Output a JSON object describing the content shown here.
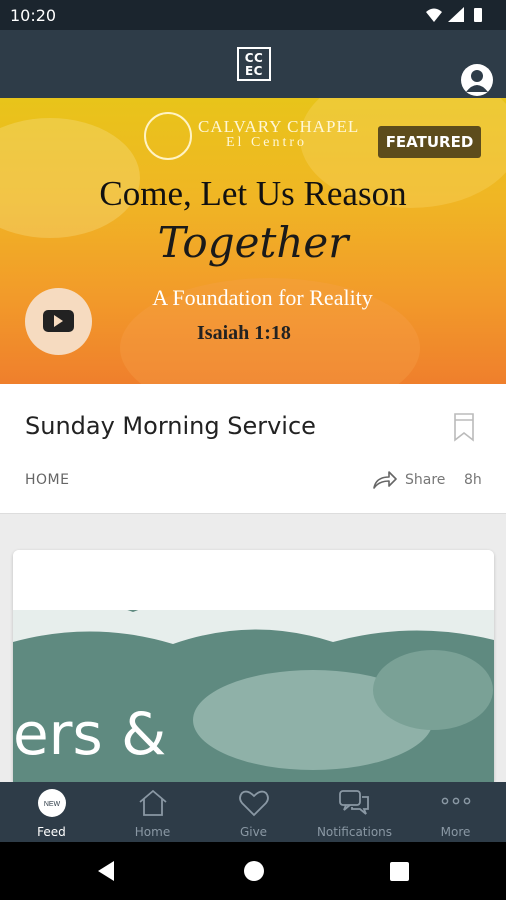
{
  "status_bar": {
    "time": "10:20"
  },
  "app_bar": {
    "logo_text_line1": "CC",
    "logo_text_line2": "EC"
  },
  "featured": {
    "church_name_line1": "CALVARY CHAPEL",
    "church_name_line2": "El Centro",
    "badge": "FEATURED",
    "title": "Come, Let Us Reason",
    "script_title": "Together",
    "subtitle": "A Foundation for Reality",
    "scripture_ref": "Isaiah 1:18"
  },
  "feed_item": {
    "title": "Sunday Morning Service",
    "category": "HOME",
    "share_label": "Share",
    "time_ago": "8h"
  },
  "next_card": {
    "partial_text": "ers &"
  },
  "tab_bar": {
    "feed_badge": "NEW",
    "tabs": [
      {
        "label": "Feed",
        "icon": "new-badge-icon"
      },
      {
        "label": "Home",
        "icon": "home-icon"
      },
      {
        "label": "Give",
        "icon": "heart-icon"
      },
      {
        "label": "Notifications",
        "icon": "chat-bubbles-icon"
      },
      {
        "label": "More",
        "icon": "more-dots-icon"
      }
    ]
  },
  "colors": {
    "app_bar": "#2e3c48",
    "status_bar": "#1b252e",
    "featured_badge": "#5d4c1c",
    "tab_inactive": "#8a98a4"
  }
}
